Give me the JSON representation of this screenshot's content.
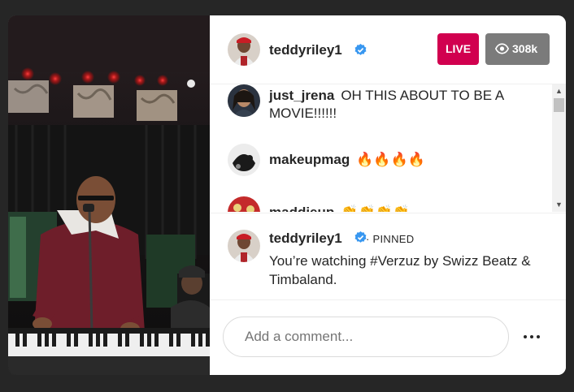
{
  "header": {
    "username": "teddyriley1",
    "live_label": "LIVE",
    "viewer_count": "308k"
  },
  "comments": [
    {
      "username": "just_jrena",
      "text": "OH THIS ABOUT TO BE A MOVIE!!!!!!"
    },
    {
      "username": "makeupmag",
      "text": "🔥🔥🔥🔥"
    },
    {
      "username": "maddieup",
      "text": "👏👏👏👏"
    }
  ],
  "pinned": {
    "username": "teddyriley1",
    "label": "· PINNED",
    "message": "You’re watching #Verzuz by Swizz Beatz & Timbaland."
  },
  "comment_input": {
    "placeholder": "Add a comment..."
  },
  "colors": {
    "live": "#d1004f",
    "viewers": "#7b7b7b",
    "verified": "#3897f0"
  }
}
